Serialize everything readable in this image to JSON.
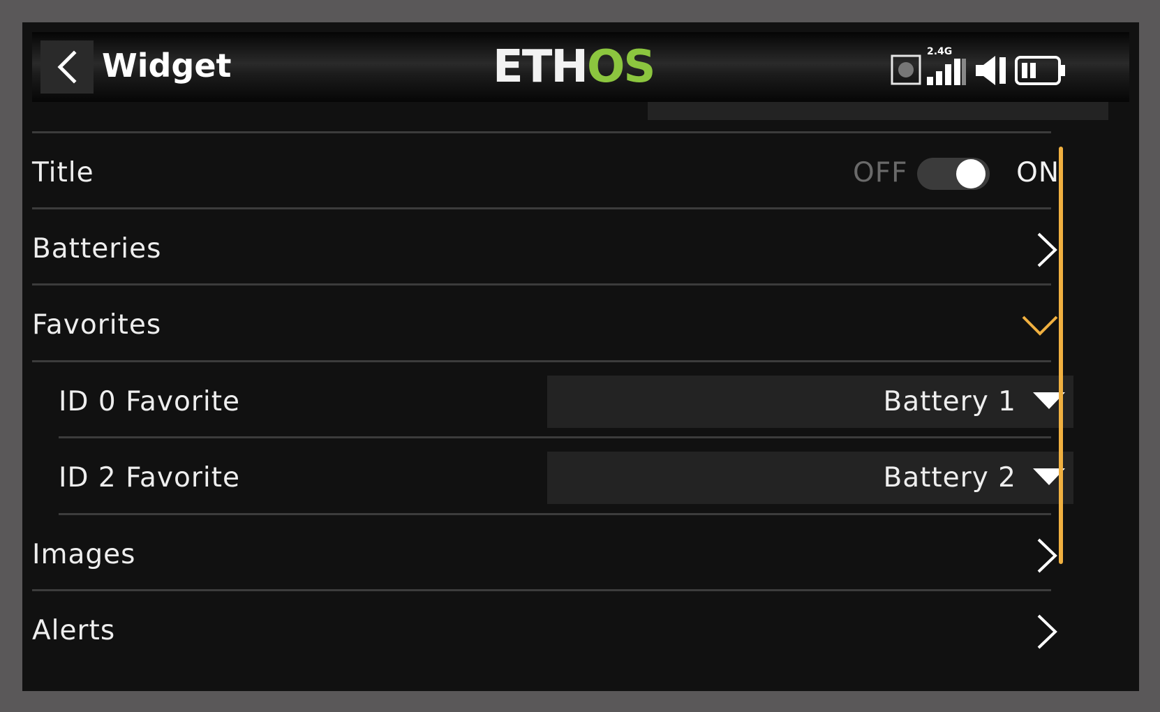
{
  "header": {
    "title": "Widget",
    "logo_part1": "ETH",
    "logo_part2": "OS",
    "signal_label": "2.4G"
  },
  "colors": {
    "accent": "#f0b040",
    "logo_green": "#8cc63f",
    "background": "#111111",
    "field": "#232323"
  },
  "rows": {
    "title": {
      "label": "Title",
      "off_label": "OFF",
      "on_label": "ON",
      "value": "ON"
    },
    "batteries": {
      "label": "Batteries"
    },
    "favorites": {
      "label": "Favorites"
    },
    "id0": {
      "label": "ID 0 Favorite",
      "value": "Battery 1"
    },
    "id2": {
      "label": "ID 2 Favorite",
      "value": "Battery 2"
    },
    "images": {
      "label": "Images"
    },
    "alerts": {
      "label": "Alerts"
    }
  },
  "icons": {
    "back": "chevron-left-icon",
    "record": "record-icon",
    "signal": "signal-bars-icon",
    "volume": "speaker-icon",
    "battery": "battery-icon",
    "expand": "chevron-right-icon",
    "collapse": "chevron-down-icon",
    "dropdown": "caret-down-icon"
  }
}
